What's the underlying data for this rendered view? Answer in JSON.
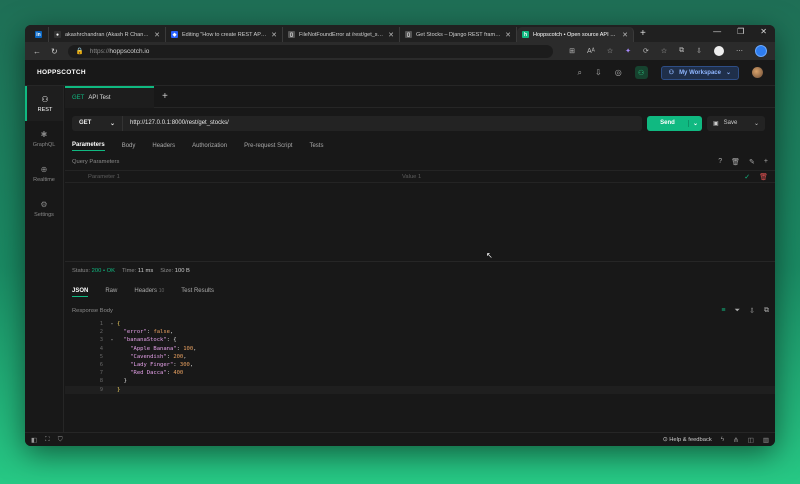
{
  "browser": {
    "tabs": [
      {
        "title": "",
        "icon": "linkedin-icon",
        "color": "#0a66c2",
        "glyph": "in",
        "first": true
      },
      {
        "title": "akashrchandran (Akash R Chandran)",
        "icon": "github-icon",
        "color": "#333333",
        "glyph": "●"
      },
      {
        "title": "Editing \"How to create REST API in Django\"",
        "icon": "hashnode-icon",
        "color": "#2962ff",
        "glyph": "◆"
      },
      {
        "title": "FileNotFoundError at /rest/get_stocks/",
        "icon": "page-icon",
        "color": "#555555",
        "glyph": "▯"
      },
      {
        "title": "Get Stocks – Django REST framework",
        "icon": "page-icon",
        "color": "#555555",
        "glyph": "▯"
      },
      {
        "title": "Hoppscotch • Open source API development ecosystem",
        "icon": "hoppscotch-icon",
        "color": "#10b981",
        "glyph": "h",
        "active": true
      }
    ],
    "url": "https://hoppscotch.io",
    "url_proto": "https://",
    "url_host": "hoppscotch.io"
  },
  "app": {
    "brand": "HOPPSCOTCH",
    "workspace": "My Workspace"
  },
  "sidebar": {
    "items": [
      {
        "label": "REST",
        "glyph": "⚇",
        "active": true
      },
      {
        "label": "GraphQL",
        "glyph": "✱"
      },
      {
        "label": "Realtime",
        "glyph": "⊕"
      },
      {
        "label": "Settings",
        "glyph": "⚙"
      }
    ]
  },
  "request": {
    "tab_method": "GET",
    "tab_name": "API Test",
    "method": "GET",
    "endpoint": "http://127.0.0.1:8000/rest/get_stocks/",
    "send_label": "Send",
    "save_label": "Save",
    "subtabs": [
      "Parameters",
      "Body",
      "Headers",
      "Authorization",
      "Pre-request Script",
      "Tests"
    ],
    "query_title": "Query Parameters",
    "param_key_placeholder": "Parameter 1",
    "param_value_placeholder": "Value 1"
  },
  "response": {
    "status_label": "Status:",
    "status_value": "200 • OK",
    "time_label": "Time:",
    "time_value": "11 ms",
    "size_label": "Size:",
    "size_value": "100 B",
    "tabs": [
      "JSON",
      "Raw",
      "Headers",
      "Test Results"
    ],
    "headers_count": "10",
    "body_title": "Response Body",
    "lines": [
      {
        "n": "1",
        "fold": "▾",
        "html": "<span class='brace'>{</span>"
      },
      {
        "n": "2",
        "fold": "",
        "html": "  <span class='key'>\"error\"</span>: <span class='bool'>false</span>,"
      },
      {
        "n": "3",
        "fold": "▾",
        "html": "  <span class='key'>\"bananaStock\"</span>: {"
      },
      {
        "n": "4",
        "fold": "",
        "html": "    <span class='key'>\"Apple Banana\"</span>: <span class='num'>100</span>,"
      },
      {
        "n": "5",
        "fold": "",
        "html": "    <span class='key'>\"Cavendish\"</span>: <span class='num'>200</span>,"
      },
      {
        "n": "6",
        "fold": "",
        "html": "    <span class='key'>\"Lady Finger\"</span>: <span class='num'>300</span>,"
      },
      {
        "n": "7",
        "fold": "",
        "html": "    <span class='key'>\"Red Dacca\"</span>: <span class='num'>400</span>"
      },
      {
        "n": "8",
        "fold": "",
        "html": "  }"
      },
      {
        "n": "9",
        "fold": "",
        "html": "<span class='brace'>}</span>",
        "cur": true
      }
    ]
  },
  "footer": {
    "help_label": "Help & feedback"
  },
  "colors": {
    "accent": "#10b981",
    "background": "#181818"
  }
}
